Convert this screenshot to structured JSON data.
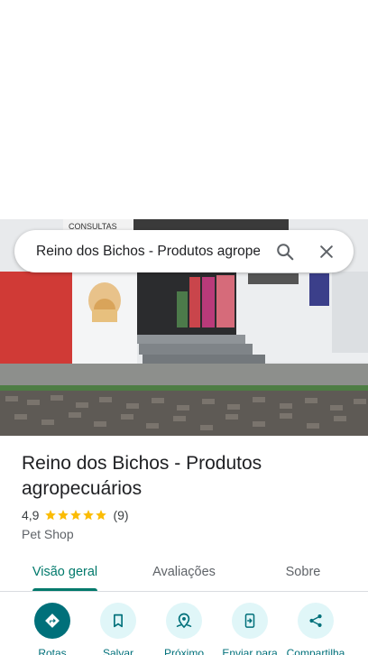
{
  "search": {
    "query": "Reino dos Bichos - Produtos agropecuários",
    "search_icon": "search-icon",
    "close_icon": "close-icon"
  },
  "photo": {
    "sign_text": "CONSULTAS"
  },
  "place": {
    "name": "Reino dos Bichos - Produtos agropecuários",
    "rating": "4,9",
    "review_count": "(9)",
    "stars": 5,
    "category": "Pet Shop"
  },
  "tabs": [
    {
      "label": "Visão geral",
      "active": true
    },
    {
      "label": "Avaliações",
      "active": false
    },
    {
      "label": "Sobre",
      "active": false
    }
  ],
  "actions": [
    {
      "label": "Rotas",
      "icon": "directions-icon"
    },
    {
      "label": "Salvar",
      "icon": "bookmark-icon"
    },
    {
      "label": "Próximo",
      "icon": "nearby-icon"
    },
    {
      "label": "Enviar para",
      "icon": "send-to-phone-icon"
    },
    {
      "label": "Compartilha",
      "icon": "share-icon"
    }
  ],
  "colors": {
    "accent": "#00796b",
    "star": "#fbbc04",
    "action_bg": "#e0f6f8",
    "action_primary": "#00707a"
  }
}
